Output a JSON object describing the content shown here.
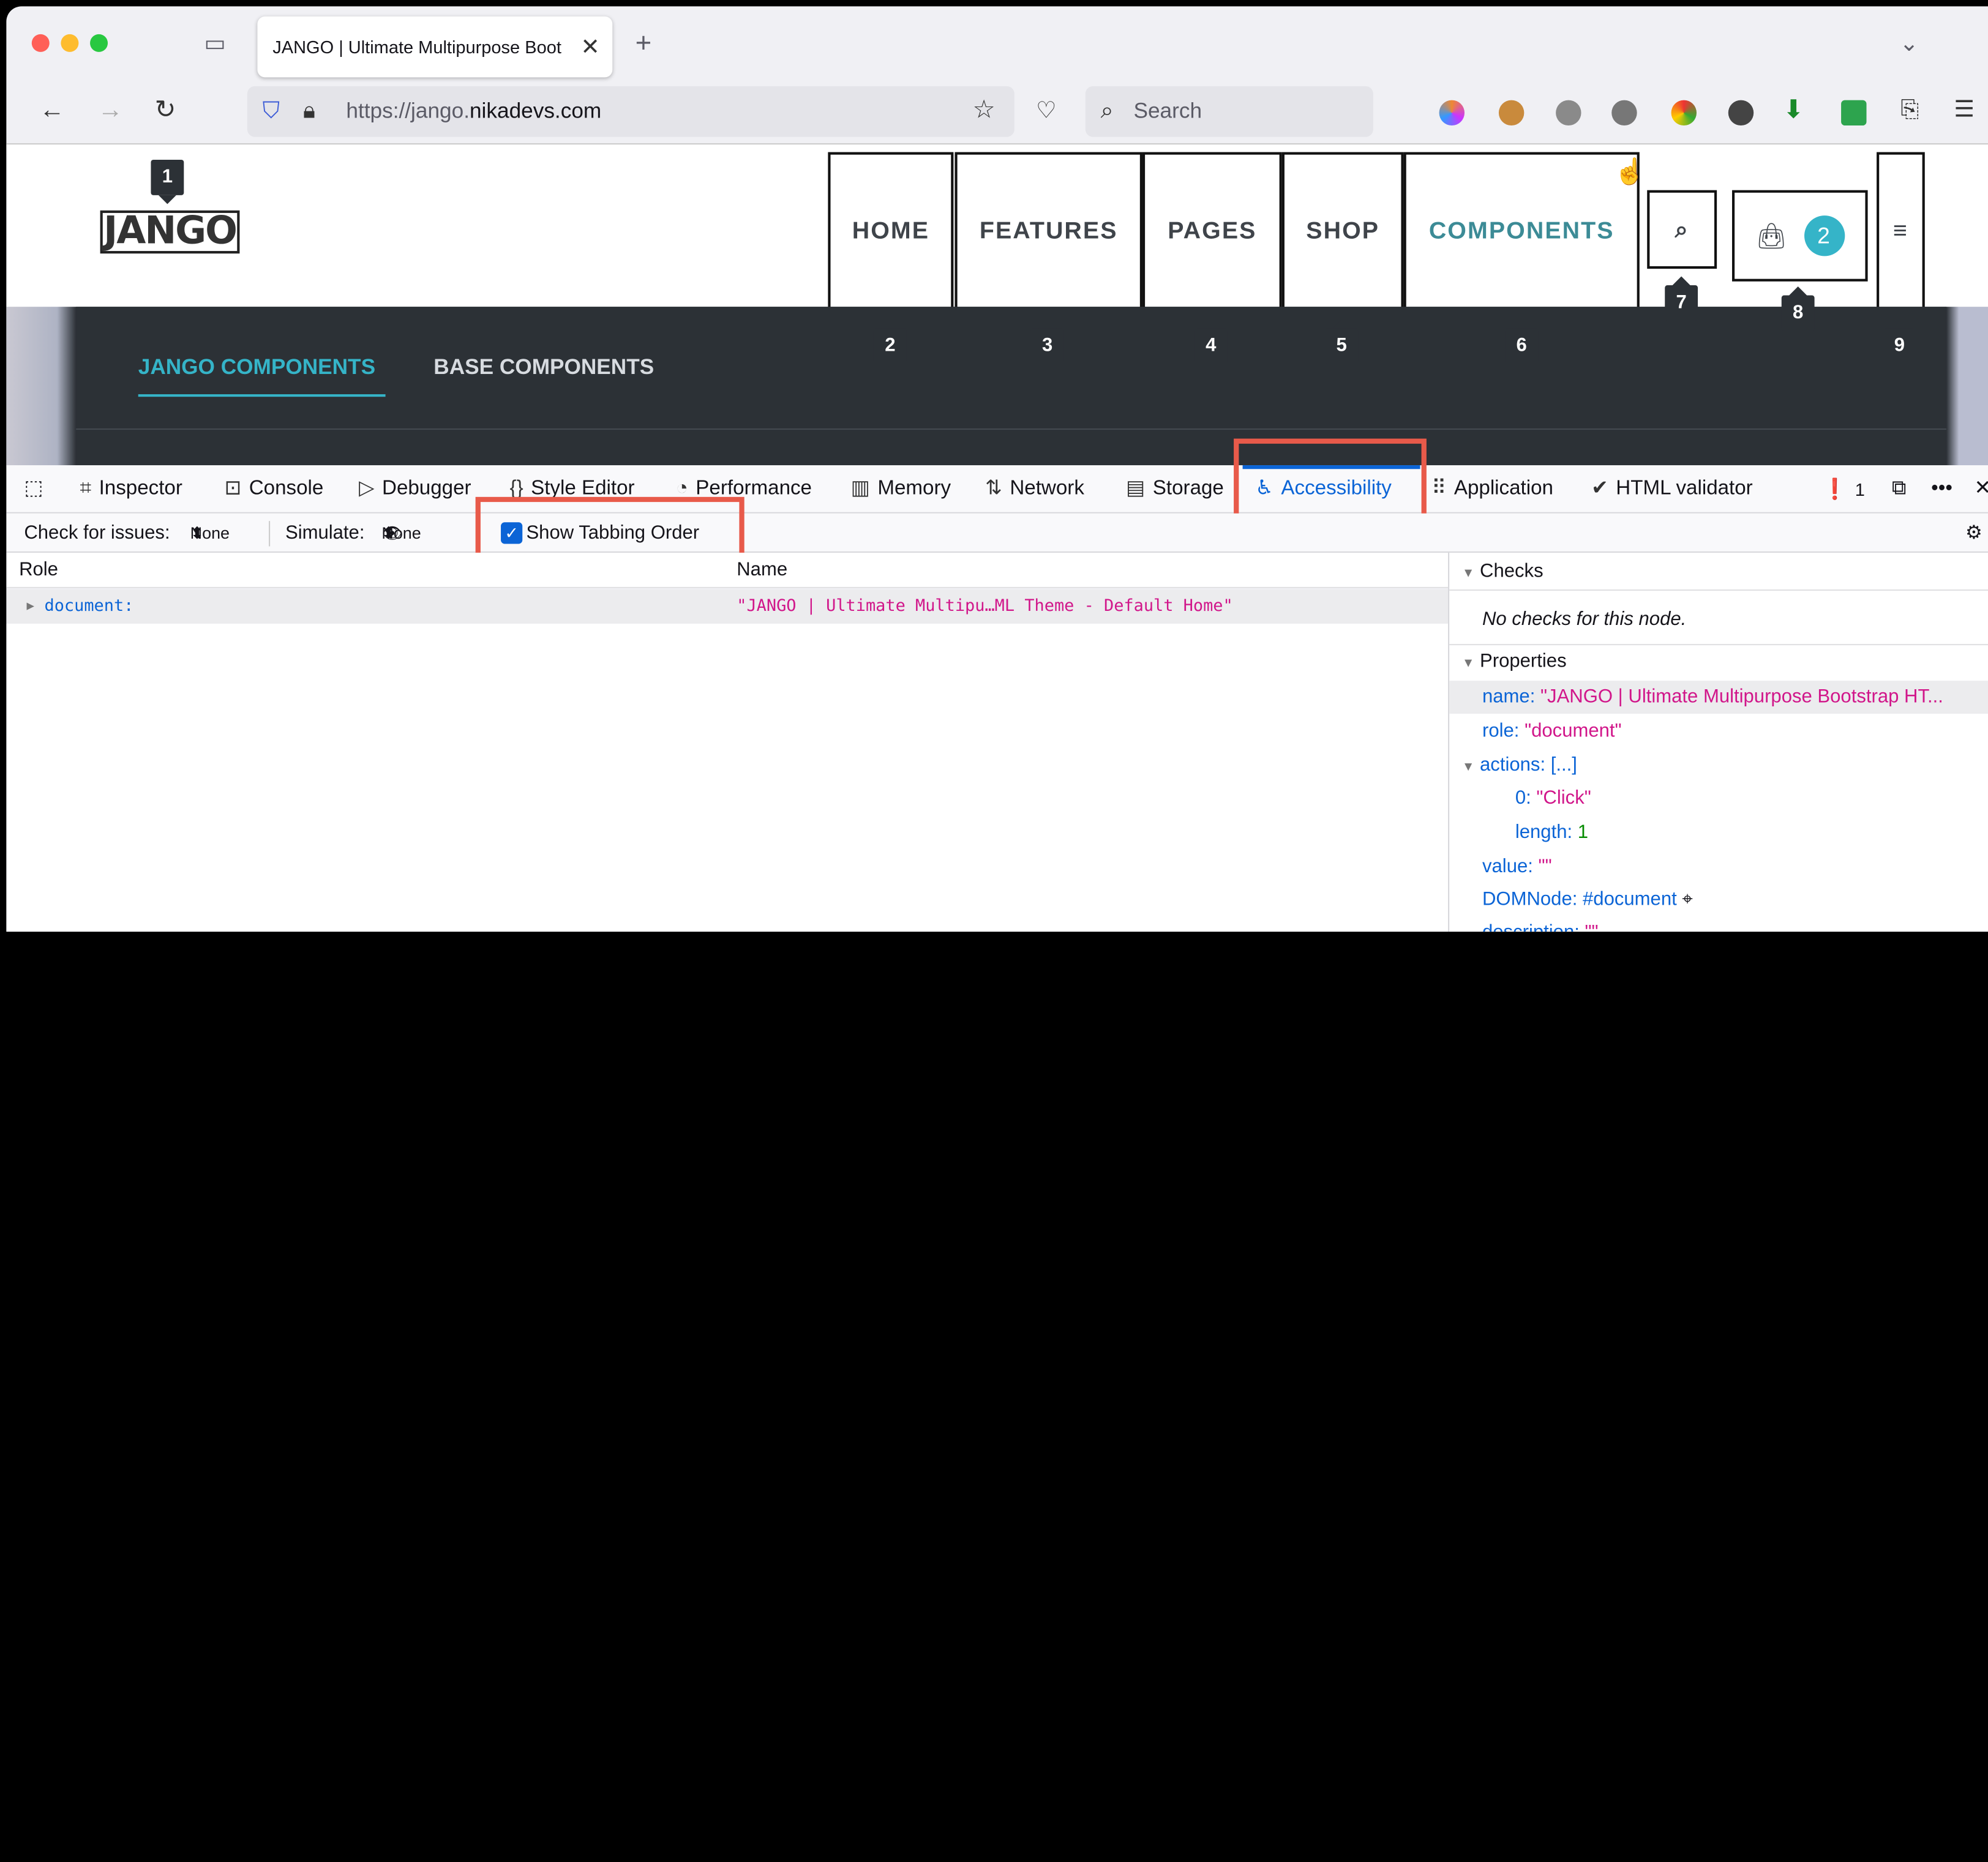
{
  "browser": {
    "tab_title": "JANGO | Ultimate Multipurpose Boot",
    "url_prefix": "https://jango.",
    "url_domain": "nikadevs.com",
    "search_placeholder": "Search"
  },
  "site": {
    "logo": "JANGO",
    "nav": [
      "HOME",
      "FEATURES",
      "PAGES",
      "SHOP",
      "COMPONENTS"
    ],
    "cart_count": "2",
    "tab_order_badges": [
      "1",
      "2",
      "3",
      "4",
      "5",
      "6",
      "7",
      "8",
      "9"
    ],
    "subnav": [
      "JANGO COMPONENTS",
      "BASE COMPONENTS"
    ]
  },
  "devtools": {
    "tabs": [
      "Inspector",
      "Console",
      "Debugger",
      "Style Editor",
      "Performance",
      "Memory",
      "Network",
      "Storage",
      "Accessibility",
      "Application",
      "HTML validator"
    ],
    "error_count": "1",
    "check_for_issues_label": "Check for issues:",
    "check_for_issues_value": "None",
    "simulate_label": "Simulate:",
    "simulate_value": "None",
    "show_tabbing_order": "Show Tabbing Order",
    "col_role": "Role",
    "col_name": "Name",
    "row_role": "document:",
    "row_name": "\"JANGO | Ultimate Multipu…ML Theme - Default Home\"",
    "checks_header": "Checks",
    "checks_text": "No checks for this node.",
    "properties_header": "Properties",
    "props": {
      "name_key": "name:",
      "name_val": "\"JANGO | Ultimate Multipurpose Bootstrap HT...",
      "role_key": "role:",
      "role_val": "\"document\"",
      "actions_key": "actions:",
      "actions_val": "[...]",
      "action0_key": "0:",
      "action0_val": "\"Click\"",
      "length_key": "length:",
      "length_val": "1",
      "value_key": "value:",
      "value_val": "\"\"",
      "domnode_key": "DOMNode:",
      "domnode_val": "#document",
      "description_key": "description:",
      "description_val": "\"\""
    }
  },
  "colors": {
    "accent": "#0b64d6",
    "highlight_box": "#e85a4a",
    "nav_active": "#3c8b96"
  }
}
